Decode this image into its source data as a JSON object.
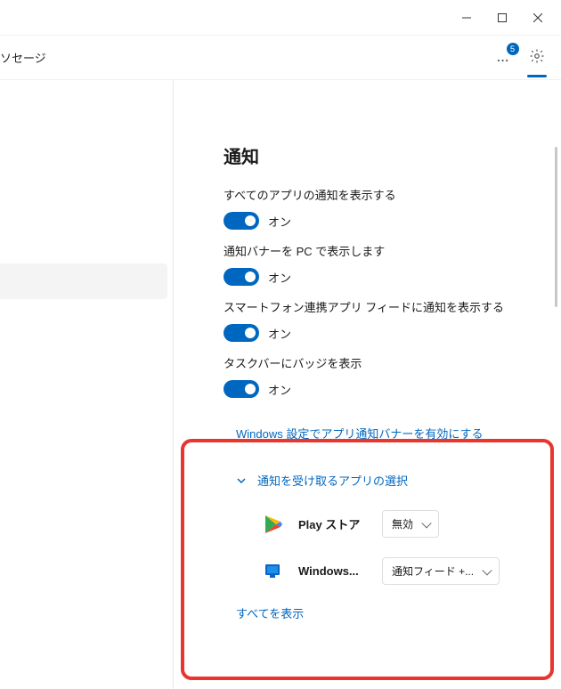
{
  "titlebar": {},
  "header": {
    "left_text": "ソセージ",
    "badge_count": "5"
  },
  "content": {
    "heading": "通知",
    "settings": [
      {
        "label": "すべてのアプリの通知を表示する",
        "state": "オン"
      },
      {
        "label": "通知バナーを PC で表示します",
        "state": "オン"
      },
      {
        "label": "スマートフォン連携アプリ フィードに通知を表示する",
        "state": "オン"
      },
      {
        "label": "タスクバーにバッジを表示",
        "state": "オン"
      }
    ],
    "link_text": "Windows 設定でアプリ通知バナーを有効にする",
    "expand_label": "通知を受け取るアプリの選択",
    "apps": [
      {
        "name": "Play ストア",
        "dropdown": "無効"
      },
      {
        "name": "Windows...",
        "dropdown": "通知フィード +..."
      }
    ],
    "show_all": "すべてを表示"
  }
}
